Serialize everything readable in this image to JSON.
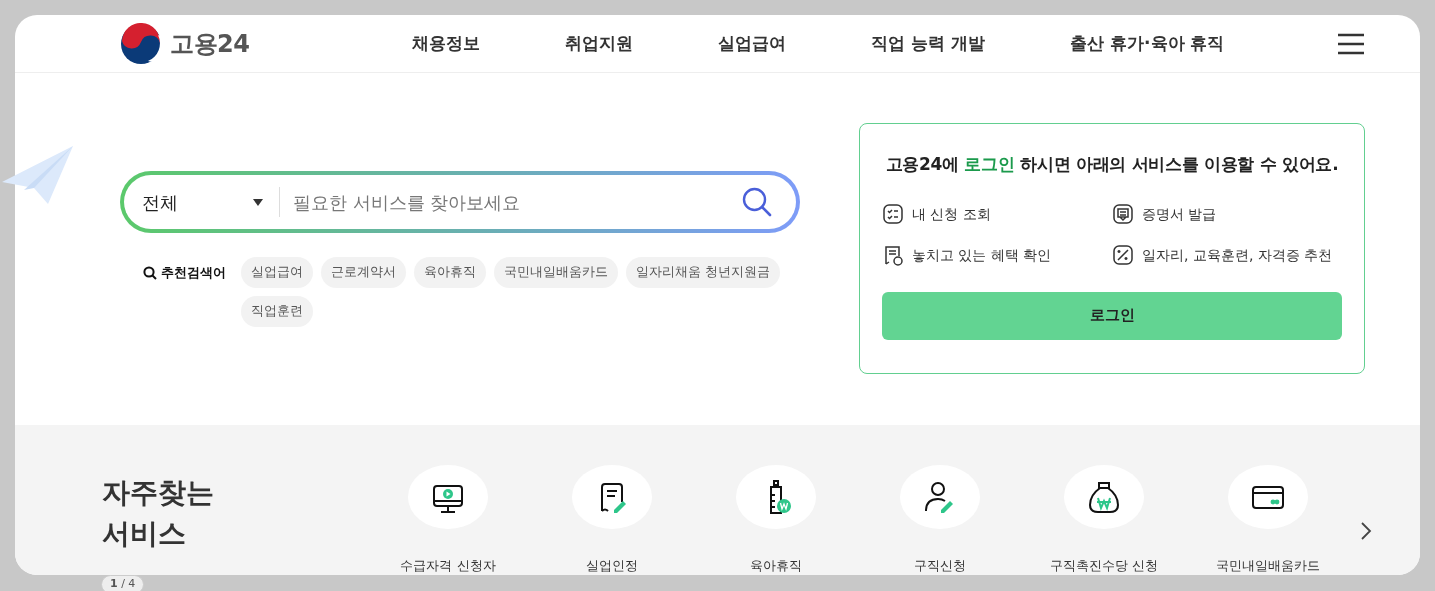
{
  "header": {
    "logo_text": "고용24",
    "nav": [
      "채용정보",
      "취업지원",
      "실업급여",
      "직업 능력 개발",
      "출산 휴가·육아 휴직"
    ]
  },
  "search": {
    "scope": "전체",
    "placeholder": "필요한 서비스를 찾아보세요"
  },
  "recommended": {
    "label": "추천검색어",
    "keywords": [
      "실업급여",
      "근로계약서",
      "육아휴직",
      "국민내일배움카드",
      "일자리채움 청년지원금",
      "직업훈련"
    ]
  },
  "login_card": {
    "title": {
      "before": "고용24에 ",
      "highlight": "로그인",
      "after": " 하시면 아래의 서비스를 이용할 수 있어요."
    },
    "features": [
      "내 신청 조회",
      "증명서 발급",
      "놓치고 있는 혜택 확인",
      "일자리, 교육훈련, 자격증 추천"
    ],
    "button": "로그인"
  },
  "frequent": {
    "title": "자주찾는 서비스",
    "pager": "**1** / 4",
    "services": [
      "수급자격 신청자",
      "실업인정",
      "육아휴직",
      "구직신청",
      "구직촉진수당 신청",
      "국민내일배움카드"
    ]
  }
}
